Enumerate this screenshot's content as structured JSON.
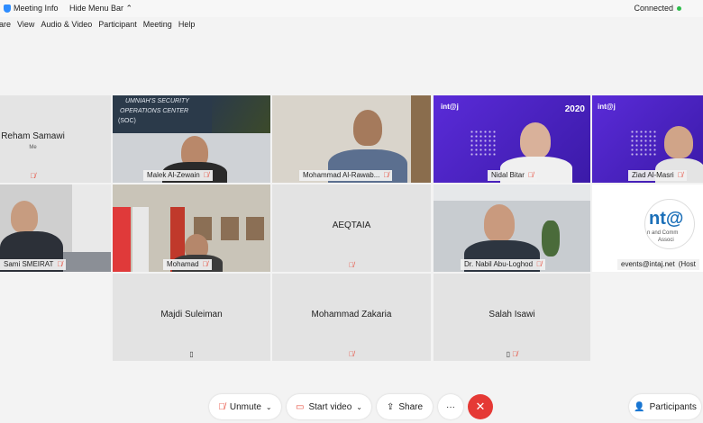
{
  "window": {
    "title": "Meeting Info",
    "hide_menu": "Hide Menu Bar",
    "status": "Connected"
  },
  "menu": [
    "hare",
    "View",
    "Audio & Video",
    "Participant",
    "Meeting",
    "Help"
  ],
  "participants": {
    "reham": {
      "name": "Reham Samawi",
      "sub": "Me"
    },
    "malek": {
      "name": "Malek Al-Zewain",
      "banner1": "UMNIAH'S SECURITY",
      "banner2": "OPERATIONS CENTER",
      "banner3": "(SOC)"
    },
    "mohammad_r": {
      "name": "Mohammad Al-Rawab..."
    },
    "nidal": {
      "name": "Nidal Bitar",
      "logo": "int@j",
      "year": "2020"
    },
    "ziad": {
      "name": "Ziad Al-Masri",
      "logo": "int@j"
    },
    "sami": {
      "name": "Sami SMEIRAT"
    },
    "mohamad": {
      "name": "Mohamad"
    },
    "aeqtaia": {
      "name": "AEQTAIA"
    },
    "nabil": {
      "name": "Dr. Nabil Abu-Loghod"
    },
    "events": {
      "name": "events@intaj.net",
      "host": "(Host",
      "logo": "nt@",
      "logo_sub1": "n and Comm",
      "logo_sub2": "Associ"
    },
    "majdi": {
      "name": "Majdi Suleiman"
    },
    "zakaria": {
      "name": "Mohammad Zakaria"
    },
    "salah": {
      "name": "Salah Isawi"
    }
  },
  "controls": {
    "unmute": "Unmute",
    "start_video": "Start video",
    "share": "Share",
    "more": "···",
    "end": "✕",
    "participants": "Participants"
  },
  "colors": {
    "mic_off": "#e74c3c",
    "end_red": "#e53935",
    "connected_green": "#2cbd4a"
  }
}
